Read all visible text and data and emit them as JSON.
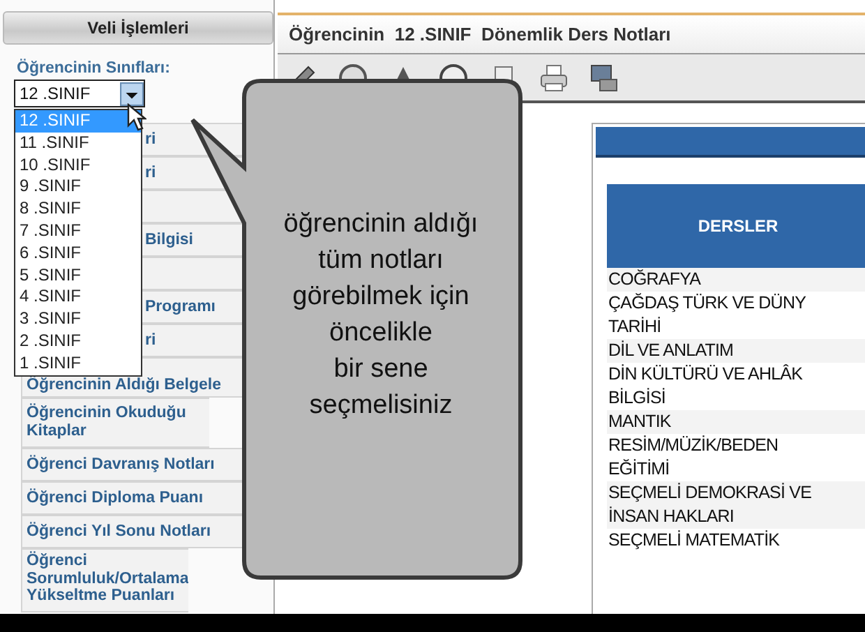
{
  "sidebar": {
    "title": "Veli İşlemleri",
    "class_label": "Öğrencinin Sınıfları:",
    "class_select": {
      "value": "12 .SINIF",
      "expanded": true,
      "options": [
        {
          "label": "12 .SINIF",
          "selected": true
        },
        {
          "label": "11 .SINIF",
          "selected": false
        },
        {
          "label": "10 .SINIF",
          "selected": false
        },
        {
          "label": "9 .SINIF",
          "selected": false
        },
        {
          "label": "8 .SINIF",
          "selected": false
        },
        {
          "label": "7 .SINIF",
          "selected": false
        },
        {
          "label": "6 .SINIF",
          "selected": false
        },
        {
          "label": "5 .SINIF",
          "selected": false
        },
        {
          "label": "4 .SINIF",
          "selected": false
        },
        {
          "label": "3 .SINIF",
          "selected": false
        },
        {
          "label": "2 .SINIF",
          "selected": false
        },
        {
          "label": "1 .SINIF",
          "selected": false
        }
      ]
    },
    "menu": [
      {
        "kind": "partial",
        "text": "ri"
      },
      {
        "kind": "partial",
        "text": "ri"
      },
      {
        "kind": "hidden"
      },
      {
        "kind": "partial",
        "text": "Bilgisi"
      },
      {
        "kind": "hidden"
      },
      {
        "kind": "partial",
        "text": "Programı"
      },
      {
        "kind": "partial",
        "text": "ri"
      },
      {
        "kind": "full",
        "text": "Öğrencinin Aldığı Belgele"
      },
      {
        "kind": "full",
        "text": "Öğrencinin Okuduğu Kitaplar"
      },
      {
        "kind": "full",
        "text": "Öğrenci Davranış Notları"
      },
      {
        "kind": "full",
        "text": "Öğrenci Diploma Puanı"
      },
      {
        "kind": "full",
        "text": "Öğrenci Yıl Sonu Notları"
      },
      {
        "kind": "full",
        "text": "Öğrenci Sorumluluk/Ortalama Yükseltme Puanları"
      }
    ]
  },
  "main": {
    "title": "Öğrencinin  12 .SINIF  Dönemlik Ders Notları",
    "table": {
      "column": "DERSLER",
      "rows": [
        "COĞRAFYA",
        "ÇAĞDAŞ TÜRK VE DÜNY\nTARİHİ",
        "DİL VE ANLATIM",
        "DİN KÜLTÜRÜ VE AHLÂK\nBİLGİSİ",
        "MANTIK",
        "RESİM/MÜZİK/BEDEN\nEĞİTİMİ",
        "SEÇMELİ DEMOKRASİ VE\nİNSAN HAKLARI",
        "SEÇMELİ MATEMATİK"
      ]
    }
  },
  "callout": {
    "text": "öğrencinin aldığı\ntüm notları\ngörebilmek için\nöncelikle\nbir sene\nseçmelisiniz"
  }
}
